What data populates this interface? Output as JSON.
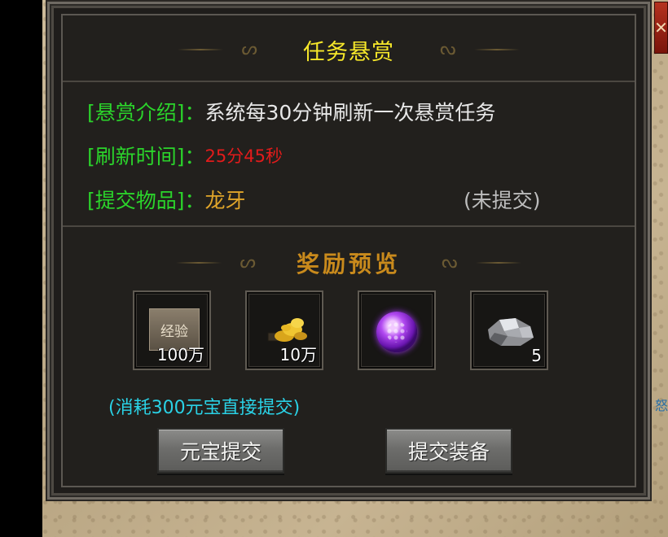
{
  "panel": {
    "title": "任务悬赏",
    "info": {
      "intro_label": "[悬赏介绍]：",
      "intro_text": "系统每30分钟刷新一次悬赏任务",
      "refresh_label": "[刷新时间]：",
      "refresh_value": "25分45秒",
      "item_label": "[提交物品]：",
      "item_name": "龙牙",
      "item_status": "(未提交)"
    },
    "reward_title": "奖励预览",
    "rewards": [
      {
        "icon": "exp-icon",
        "icon_text": "经验",
        "count": "100万"
      },
      {
        "icon": "gold-pile-icon",
        "count": "10万"
      },
      {
        "icon": "purple-orb-icon",
        "count": ""
      },
      {
        "icon": "silver-ore-icon",
        "count": "5"
      }
    ],
    "submit_hint": "(消耗300元宝直接提交)",
    "buttons": {
      "yuanbao_submit": "元宝提交",
      "submit_equipment": "提交装备"
    }
  },
  "colors": {
    "title": "#f6e72a",
    "label": "#2bd42b",
    "countdown": "#e21b1b",
    "item_name": "#e0a52a",
    "hint": "#2ad2e6",
    "reward_title": "#c98a1c"
  }
}
